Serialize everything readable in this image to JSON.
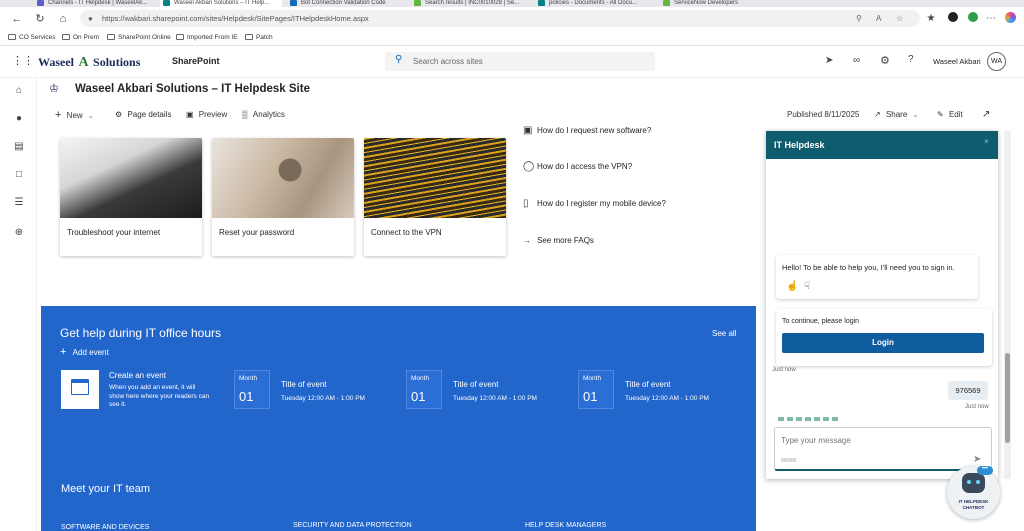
{
  "browser": {
    "tabs": [
      {
        "label": "Channels - IT Helpdesk | WaseelAk...",
        "active": false,
        "icon_color": "#5b5fc7"
      },
      {
        "label": "Waseel Akbari Solutions – IT Help...",
        "active": true,
        "icon_color": "#038387"
      },
      {
        "label": "Bot Connection Validation Code",
        "active": false,
        "icon_color": "#0f6cbd"
      },
      {
        "label": "Search results | INC0010028 | Se...",
        "active": false,
        "icon_color": "#62b83b"
      },
      {
        "label": "policies - Documents - All Docu...",
        "active": false,
        "icon_color": "#038387"
      },
      {
        "label": "ServiceNow Developers",
        "active": false,
        "icon_color": "#62b83b"
      }
    ],
    "url": "https://wakbari.sharepoint.com/sites/Helpdesk/SitePages/ITHelpdeskHome.aspx",
    "bookmarks": [
      "CO Services",
      "On Prem",
      "SharePoint Online",
      "Imported From IE",
      "Patch"
    ]
  },
  "suite": {
    "logo_text_1": "Waseel",
    "logo_text_2": "Solutions",
    "app_name": "SharePoint",
    "search_placeholder": "Search across sites",
    "user_name": "Waseel Akbari",
    "user_initials": "WA"
  },
  "site": {
    "title": "Waseel Akbari Solutions – IT Helpdesk Site",
    "commands": {
      "new": "New",
      "page_details": "Page details",
      "preview": "Preview",
      "analytics": "Analytics"
    },
    "published": "Published 8/11/2025",
    "share": "Share",
    "edit": "Edit"
  },
  "cards": [
    {
      "label": "Troubleshoot your internet"
    },
    {
      "label": "Reset your password"
    },
    {
      "label": "Connect to the VPN"
    }
  ],
  "faqs": [
    {
      "label": "How do I request new software?"
    },
    {
      "label": "How do I access the VPN?"
    },
    {
      "label": "How do I register my mobile device?"
    }
  ],
  "faq_more": "See more FAQs",
  "events": {
    "heading": "Get help during IT office hours",
    "see_all": "See all",
    "add_event": "Add event",
    "create_title": "Create an event",
    "create_desc_1": "When you add an event, it will",
    "create_desc_2": "show here where your readers can",
    "create_desc_3": "see it.",
    "items": [
      {
        "month": "Month",
        "day": "01",
        "title": "Title of event",
        "time": "Tuesday 12:00 AM - 1:00 PM"
      },
      {
        "month": "Month",
        "day": "01",
        "title": "Title of event",
        "time": "Tuesday 12:00 AM - 1:00 PM"
      },
      {
        "month": "Month",
        "day": "01",
        "title": "Title of event",
        "time": "Tuesday 12:00 AM - 1:00 PM"
      }
    ]
  },
  "team": {
    "heading": "Meet your IT team",
    "columns": [
      "SOFTWARE AND DEVICES",
      "SECURITY AND DATA PROTECTION",
      "HELP DESK MANAGERS"
    ]
  },
  "chat": {
    "title": "IT Helpdesk",
    "bot_message": "Hello! To be able to help you, I'll need you to sign in.",
    "login_prompt": "To continue, please login",
    "login_button": "Login",
    "bot_time": "Just now",
    "user_message": "976569",
    "user_time": "Just now",
    "input_placeholder": "Type your message",
    "char_count": "0/5000"
  },
  "chatbot_badge": {
    "line1": "IT HELPDESK",
    "line2": "CHATBOT"
  },
  "colors": {
    "accent": "#2266cc",
    "chat_header": "#0f5c6e",
    "login_button": "#0f5c9e",
    "logo_green": "#2e7d32"
  }
}
